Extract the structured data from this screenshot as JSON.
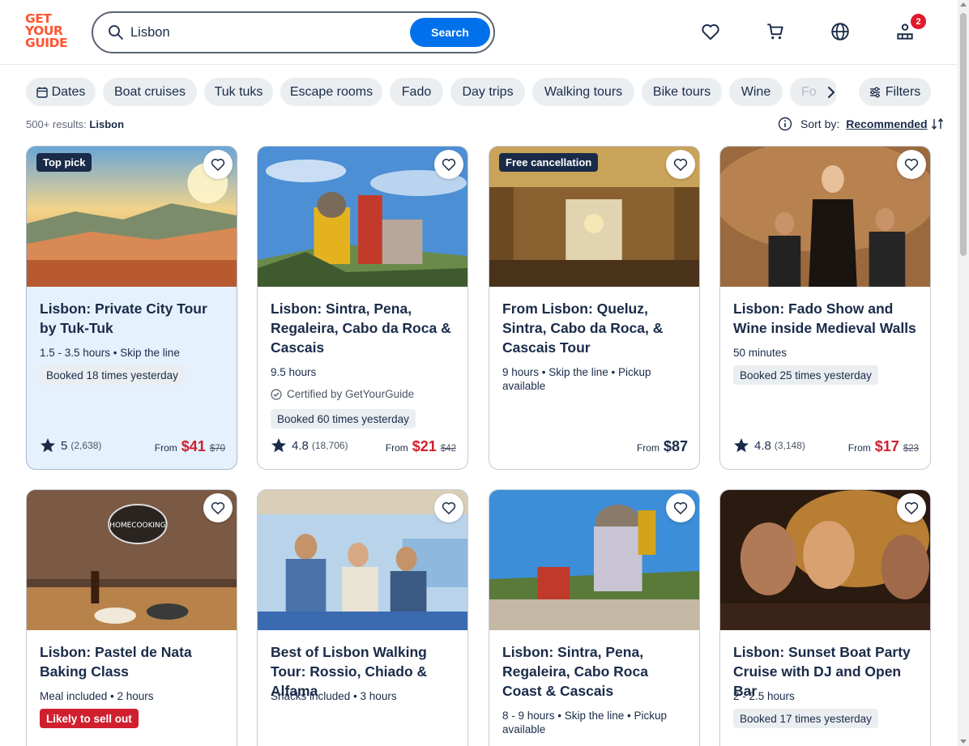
{
  "logo": {
    "lines": [
      "GET",
      "YOUR",
      "GUIDE"
    ]
  },
  "search": {
    "value": "Lisbon",
    "button_label": "Search"
  },
  "header_icons": {
    "wishlist": "heart-icon",
    "cart": "cart-icon",
    "language": "globe-icon",
    "account": "account-icon",
    "badge_count": "2"
  },
  "chips": [
    "Dates",
    "Boat cruises",
    "Tuk tuks",
    "Escape rooms",
    "Fado",
    "Day trips",
    "Walking tours",
    "Bike tours",
    "Wine",
    "Fo"
  ],
  "filters_label": "Filters",
  "results": {
    "count": "500+ results:",
    "query": "Lisbon"
  },
  "sort": {
    "label": "Sort by:",
    "value": "Recommended"
  },
  "colors": {
    "brand": "#ff5533",
    "accent": "#0071eb",
    "sale": "#d0202f",
    "text": "#1a2b49"
  },
  "cards": [
    {
      "tag": "Top pick",
      "title": "Lisbon: Private City Tour by Tuk-Tuk",
      "meta": "1.5 - 3.5 hours • Skip the line",
      "booked": "Booked 18 times yesterday",
      "rating": "5",
      "reviews": "(2,638)",
      "from": "From",
      "price": "$41",
      "old_price": "$70"
    },
    {
      "title": "Lisbon: Sintra, Pena, Regaleira, Cabo da Roca & Cascais",
      "meta": "9.5 hours",
      "certified": "Certified by GetYourGuide",
      "booked": "Booked 60 times yesterday",
      "rating": "4.8",
      "reviews": "(18,706)",
      "from": "From",
      "price": "$21",
      "old_price": "$42"
    },
    {
      "tag": "Free cancellation",
      "title": "From Lisbon: Queluz, Sintra, Cabo da Roca, & Cascais Tour",
      "meta": "9 hours • Skip the line • Pickup available",
      "from": "From",
      "price": "$87"
    },
    {
      "title": "Lisbon: Fado Show and Wine inside Medieval Walls",
      "meta": "50 minutes",
      "booked": "Booked 25 times yesterday",
      "rating": "4.8",
      "reviews": "(3,148)",
      "from": "From",
      "price": "$17",
      "old_price": "$23"
    },
    {
      "title": "Lisbon: Pastel de Nata Baking Class",
      "meta": "Meal included • 2 hours",
      "sellout": "Likely to sell out",
      "image_text": "HOMECOOKING"
    },
    {
      "title": "Best of Lisbon Walking Tour: Rossio, Chiado & Alfama",
      "meta": "Snacks included • 3 hours"
    },
    {
      "title": "Lisbon: Sintra, Pena, Regaleira, Cabo Roca Coast & Cascais",
      "meta": "8 - 9 hours • Skip the line • Pickup available"
    },
    {
      "title": "Lisbon: Sunset Boat Party Cruise with DJ and Open Bar",
      "meta": "2 - 2.5 hours",
      "booked": "Booked 17 times yesterday"
    }
  ]
}
